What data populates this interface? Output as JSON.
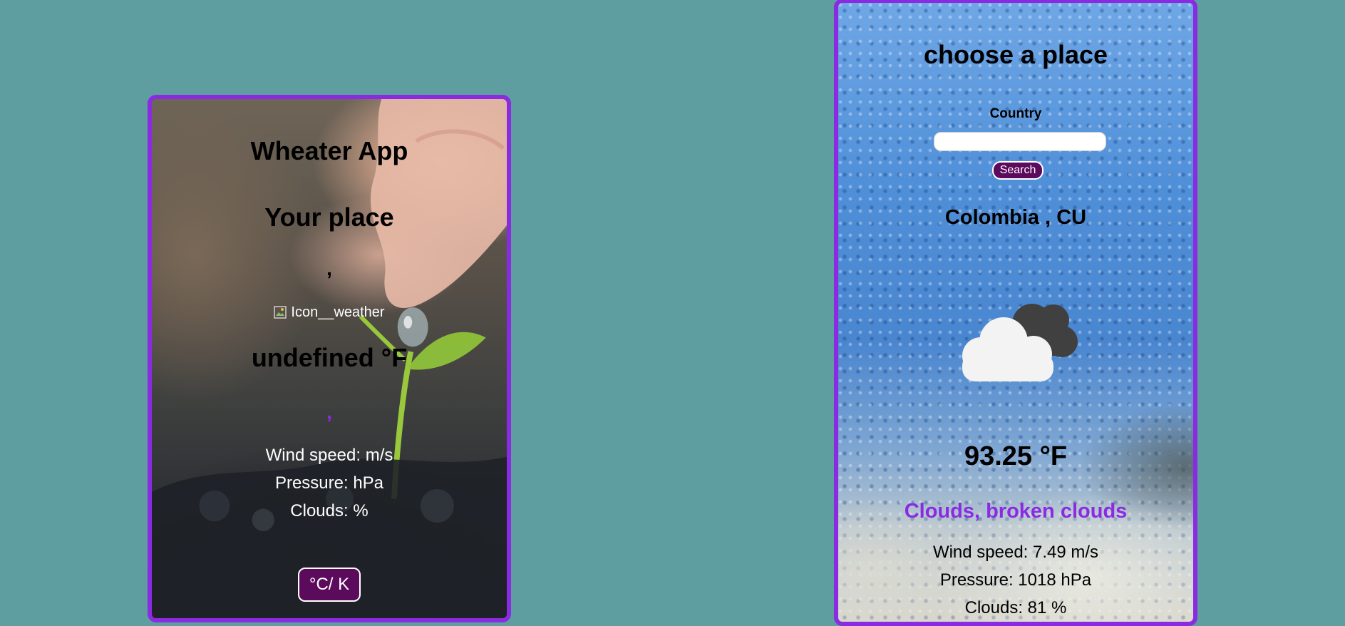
{
  "left_card": {
    "title": "Wheater App",
    "place_heading": "Your place",
    "location": ",",
    "icon_alt": "Icon__weather",
    "temperature": "undefined °F",
    "description": ",",
    "wind_speed": "Wind speed:  m/s",
    "pressure": "Pressure:  hPa",
    "clouds": "Clouds:  %",
    "unit_button": "°C/ K"
  },
  "right_card": {
    "title": "choose a place",
    "country_label": "Country",
    "country_value": "",
    "search_button": "Search",
    "location": "Colombia , CU",
    "weather_icon": "broken-clouds-icon",
    "temperature": "93.25 °F",
    "description": "Clouds, broken clouds",
    "wind_speed": "Wind speed: 7.49 m/s",
    "pressure": "Pressure: 1018 hPa",
    "clouds": "Clouds: 81 %"
  },
  "colors": {
    "page_background": "#5f9ea0",
    "card_border": "#8a2be2",
    "description_text": "#8a2be2",
    "button_background": "#5c0a5c"
  }
}
